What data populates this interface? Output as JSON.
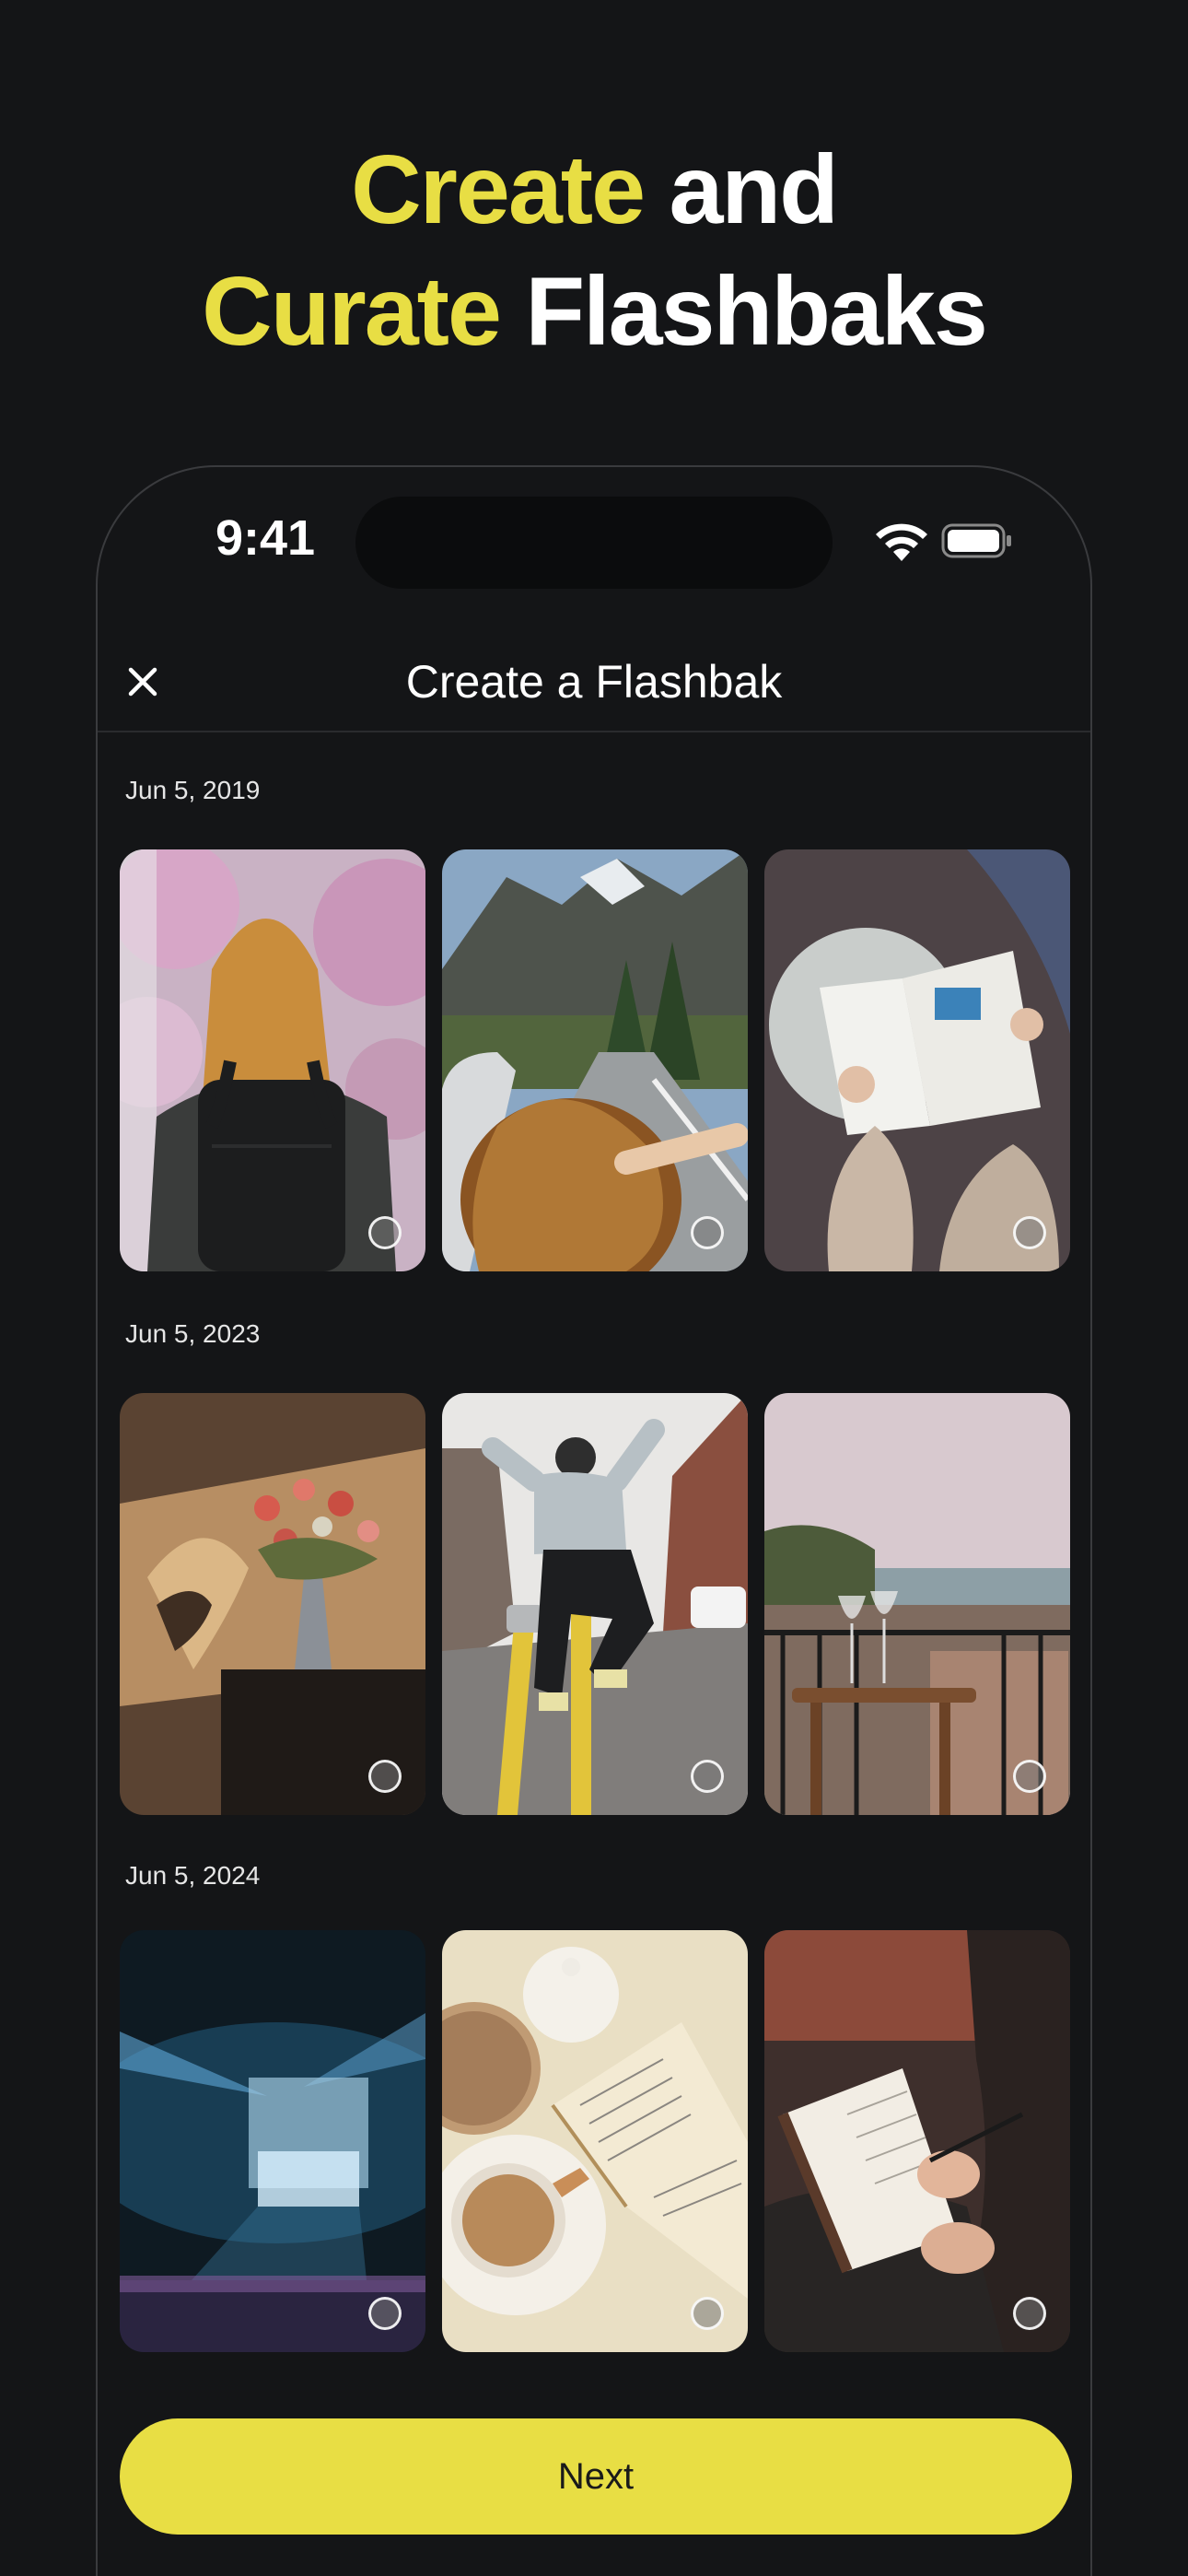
{
  "headline": {
    "line1_accent": "Create",
    "line1_plain": "and",
    "line2_accent": "Curate",
    "line2_plain": "Flashbaks"
  },
  "status_bar": {
    "time": "9:41"
  },
  "nav": {
    "title": "Create a Flashbak",
    "close_icon": "close-icon"
  },
  "sections": [
    {
      "date": "Jun 5, 2019",
      "photos": [
        "woman-with-backpack-photo",
        "car-window-mountains-photo",
        "reading-magazine-photo"
      ]
    },
    {
      "date": "Jun 5, 2023",
      "photos": [
        "flowers-vase-photo",
        "man-jumping-street-photo",
        "balcony-wine-glasses-photo"
      ]
    },
    {
      "date": "Jun 5, 2024",
      "photos": [
        "concert-stage-photo",
        "coffee-and-book-photo",
        "writing-journal-photo"
      ]
    }
  ],
  "next_button": {
    "label": "Next"
  },
  "colors": {
    "accent": "#e8de44",
    "background": "#141517"
  }
}
